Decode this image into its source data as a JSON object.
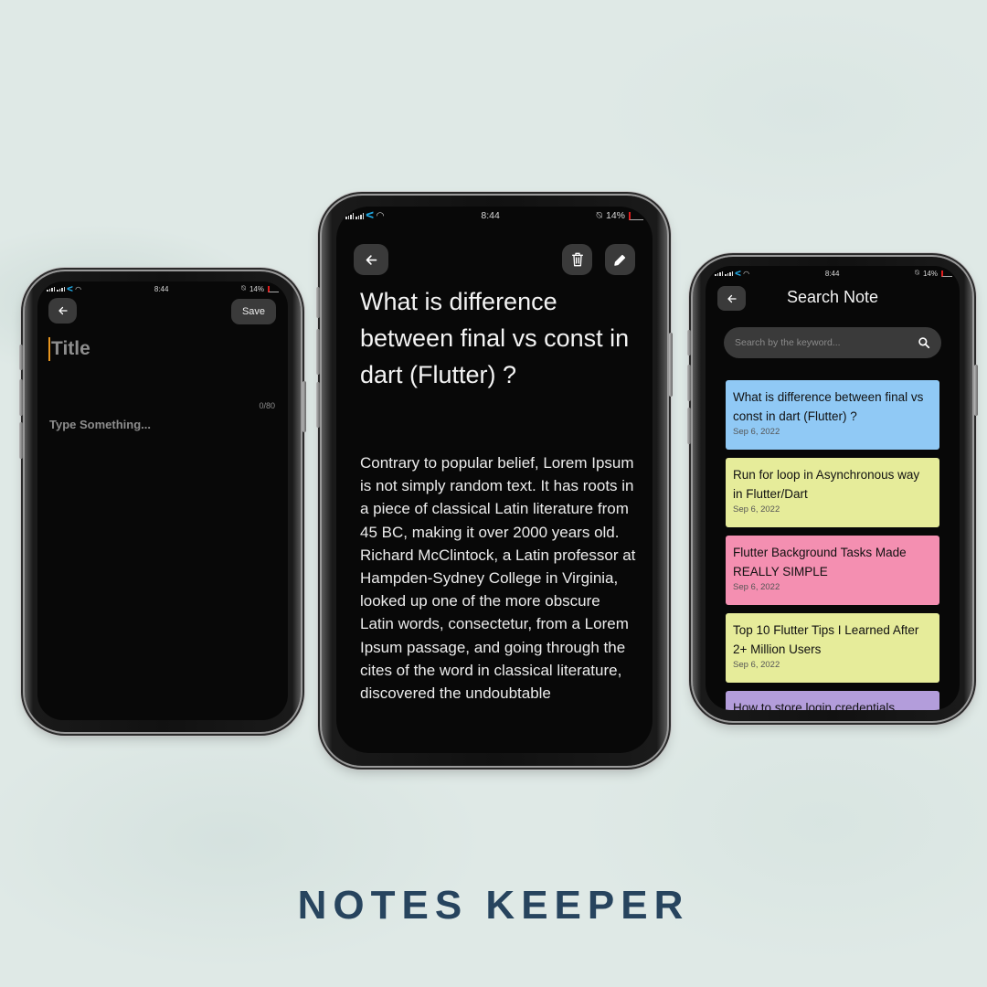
{
  "brand": {
    "title": "NOTES KEEPER",
    "color": "#27445e"
  },
  "status_bar": {
    "time": "8:44",
    "battery": "14%",
    "carrier_icon": "telenor-icon",
    "wifi_icon": "wifi-icon",
    "alarm_icon": "alarm-off-icon"
  },
  "add_note_screen": {
    "back_icon": "arrow-left-icon",
    "save_label": "Save",
    "title_placeholder": "Title",
    "char_counter": "0/80",
    "body_placeholder": "Type Something...",
    "caret_color": "#e6951f"
  },
  "note_detail_screen": {
    "back_icon": "arrow-left-icon",
    "delete_icon": "trash-icon",
    "edit_icon": "pencil-icon",
    "title": "What is difference between final vs const in dart (Flutter) ?",
    "body": "Contrary to popular belief, Lorem Ipsum is not simply random text. It has roots in a piece of classical Latin literature from 45 BC, making it over 2000 years old. Richard McClintock, a Latin professor at Hampden-Sydney College in Virginia, looked up one of the more obscure Latin words, consectetur, from a Lorem Ipsum passage, and going through the cites of the word in classical literature, discovered the undoubtable"
  },
  "search_screen": {
    "back_icon": "arrow-left-icon",
    "title": "Search Note",
    "search_placeholder": "Search by the keyword...",
    "search_icon": "search-icon",
    "notes": [
      {
        "title": "What is difference between final vs const in dart (Flutter) ?",
        "date": "Sep 6, 2022",
        "color": "#90c9f5"
      },
      {
        "title": "Run for loop in Asynchronous way in Flutter/Dart",
        "date": "Sep 6, 2022",
        "color": "#e6ec9a"
      },
      {
        "title": "Flutter Background Tasks Made REALLY SIMPLE",
        "date": "Sep 6, 2022",
        "color": "#f48fb1"
      },
      {
        "title": "Top 10 Flutter Tips I Learned After 2+ Million Users",
        "date": "Sep 6, 2022",
        "color": "#e6ec9a"
      },
      {
        "title": "How to store login credentials",
        "date": "",
        "color": "#b39ddb"
      }
    ]
  }
}
